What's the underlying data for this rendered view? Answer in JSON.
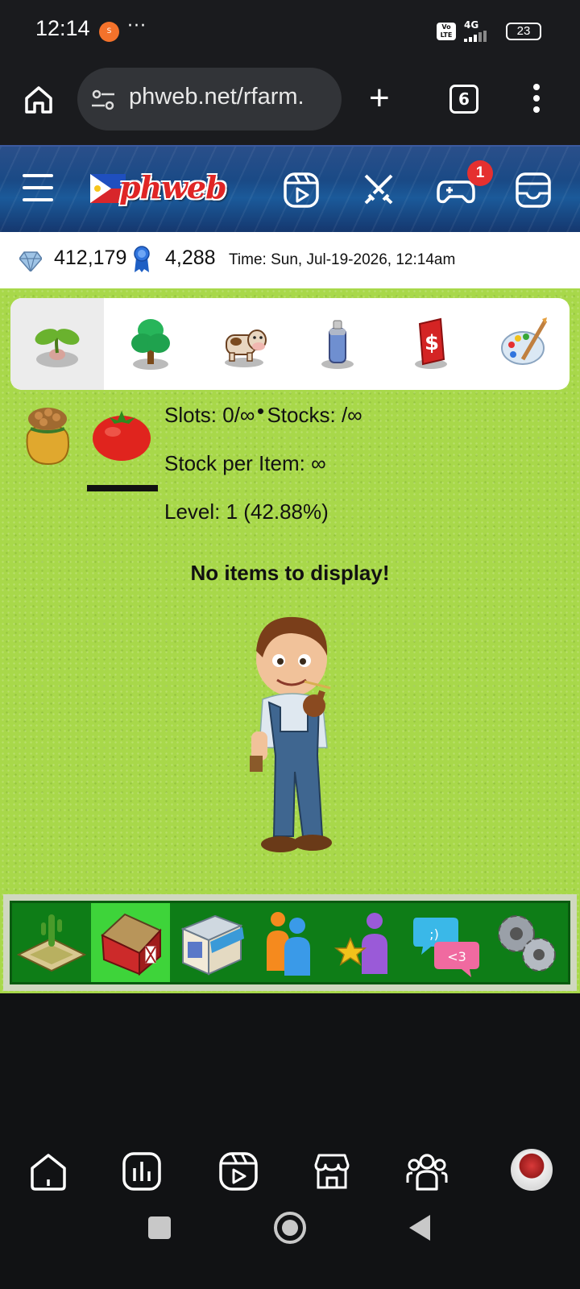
{
  "status_bar": {
    "time": "12:14",
    "notification_badge": "S",
    "more": "···",
    "volte": "Vo LTE",
    "network": "4G",
    "battery": "23",
    "icons": [
      "notification-app-icon",
      "volte-icon",
      "signal-icon",
      "battery-icon"
    ]
  },
  "browser": {
    "url": "phweb.net/rfarm.",
    "tab_count": "6",
    "icons": [
      "home-icon",
      "site-settings-icon",
      "new-tab-icon",
      "tabs-icon",
      "menu-icon"
    ]
  },
  "site_header": {
    "logo_text": "phweb",
    "notification_count": "1",
    "icons": [
      "hamburger-icon",
      "reels-icon",
      "battle-icon",
      "game-controller-icon",
      "inbox-icon"
    ]
  },
  "info_bar": {
    "gems": "412,179",
    "points": "4,288",
    "time": "Time: Sun, Jul-19-2026, 12:14am"
  },
  "category_tabs": [
    {
      "name": "seeds",
      "icon": "seedling-icon",
      "active": true
    },
    {
      "name": "trees",
      "icon": "tree-icon",
      "active": false
    },
    {
      "name": "animals",
      "icon": "cow-icon",
      "active": false
    },
    {
      "name": "spray",
      "icon": "spray-can-icon",
      "active": false
    },
    {
      "name": "cash",
      "icon": "dollar-card-icon",
      "active": false
    },
    {
      "name": "decor",
      "icon": "paint-palette-icon",
      "active": false
    }
  ],
  "item_panel": {
    "slots": "Slots: 0/∞",
    "stocks": "Stocks: /∞",
    "stock_per_item": "Stock per Item: ∞",
    "level": "Level: 1 (42.88%)",
    "empty_message": "No items to display!"
  },
  "game_nav": [
    {
      "name": "farm",
      "icon": "farm-field-icon",
      "active": false
    },
    {
      "name": "barn",
      "icon": "barn-icon",
      "active": true
    },
    {
      "name": "shop",
      "icon": "shop-icon",
      "active": false
    },
    {
      "name": "neighbors",
      "icon": "people-icon",
      "active": false
    },
    {
      "name": "rank",
      "icon": "star-person-icon",
      "active": false
    },
    {
      "name": "chat",
      "icon": "chat-bubbles-icon",
      "active": false
    },
    {
      "name": "settings",
      "icon": "gears-icon",
      "active": false
    }
  ],
  "app_nav": [
    "home-icon",
    "stats-icon",
    "reels-icon",
    "store-icon",
    "groups-icon",
    "avatar"
  ],
  "colors": {
    "game_bg": "#a8d84a",
    "nav_green": "#0e7d17",
    "nav_active": "#3ed43a",
    "badge_red": "#e53030"
  }
}
